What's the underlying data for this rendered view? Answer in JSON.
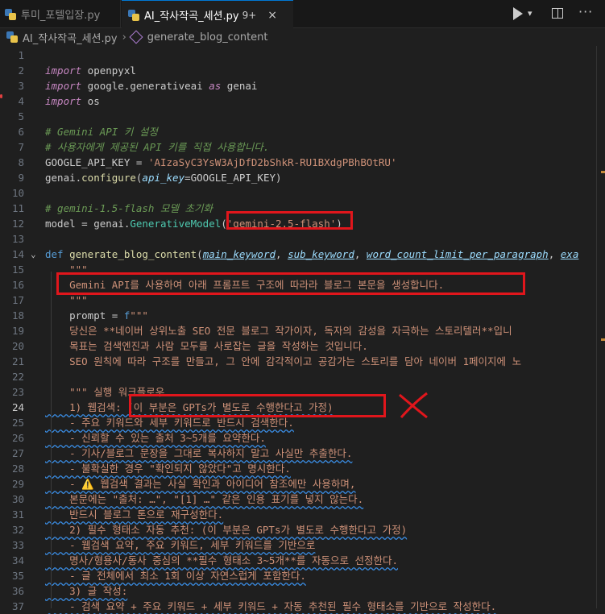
{
  "tabs": [
    {
      "label": "투미_포텔입장.py"
    },
    {
      "label": "AI_작사작곡_세션.py",
      "dirty": "9+",
      "close": "×"
    }
  ],
  "breadcrumb": {
    "file": "AI_작사작곡_세션.py",
    "separator": "›",
    "symbol": "generate_blog_content"
  },
  "colors": {
    "keyword": "#c586c0",
    "function": "#dcdcaa",
    "string": "#ce9178",
    "comment": "#6a9955",
    "annotation": "#e0161c"
  },
  "lines": [
    {
      "n": "1",
      "t": []
    },
    {
      "n": "2",
      "t": [
        {
          "c": "kw",
          "v": "import"
        },
        {
          "c": "vr",
          "v": " openpyxl"
        }
      ]
    },
    {
      "n": "3",
      "t": [
        {
          "c": "kw",
          "v": "import"
        },
        {
          "c": "vr",
          "v": " google.generativeai "
        },
        {
          "c": "kw",
          "v": "as"
        },
        {
          "c": "vr",
          "v": " genai"
        }
      ]
    },
    {
      "n": "4",
      "t": [
        {
          "c": "kw",
          "v": "import"
        },
        {
          "c": "vr",
          "v": " os"
        }
      ]
    },
    {
      "n": "5",
      "t": []
    },
    {
      "n": "6",
      "t": [
        {
          "c": "cm",
          "v": "# Gemini API 키 설정"
        }
      ]
    },
    {
      "n": "7",
      "t": [
        {
          "c": "cm",
          "v": "# 사용자에게 제공된 API 키를 직접 사용합니다."
        }
      ]
    },
    {
      "n": "8",
      "t": [
        {
          "c": "vr",
          "v": "GOOGLE_API_KEY = "
        },
        {
          "c": "st",
          "v": "'AIzaSyC3YsW3AjDfD2bShkR-RU1BXdgPBhBOtRU'"
        }
      ]
    },
    {
      "n": "9",
      "t": [
        {
          "c": "vr",
          "v": "genai."
        },
        {
          "c": "fn",
          "v": "configure"
        },
        {
          "c": "vr",
          "v": "("
        },
        {
          "c": "ky",
          "v": "api_key"
        },
        {
          "c": "vr",
          "v": "=GOOGLE_API_KEY)"
        }
      ]
    },
    {
      "n": "10",
      "t": []
    },
    {
      "n": "11",
      "t": [
        {
          "c": "cm",
          "v": "# gemini-1.5-flash 모델 초기화"
        }
      ]
    },
    {
      "n": "12",
      "t": [
        {
          "c": "vr",
          "v": "model = genai."
        },
        {
          "c": "cls",
          "v": "GenerativeModel"
        },
        {
          "c": "vr",
          "v": "("
        },
        {
          "c": "st",
          "v": "'gemini-2.5-flash'"
        },
        {
          "c": "vr",
          "v": ")"
        }
      ]
    },
    {
      "n": "13",
      "t": []
    },
    {
      "n": "14",
      "fold": "⌄",
      "t": [
        {
          "c": "df",
          "v": "def"
        },
        {
          "c": "vr",
          "v": " "
        },
        {
          "c": "fn",
          "v": "generate_blog_content"
        },
        {
          "c": "vr",
          "v": "("
        },
        {
          "c": "pm",
          "v": "main_keyword"
        },
        {
          "c": "vr",
          "v": ", "
        },
        {
          "c": "pm",
          "v": "sub_keyword"
        },
        {
          "c": "vr",
          "v": ", "
        },
        {
          "c": "pm",
          "v": "word_count_limit_per_paragraph"
        },
        {
          "c": "vr",
          "v": ", "
        },
        {
          "c": "pm",
          "v": "exa"
        }
      ]
    },
    {
      "n": "15",
      "t": [
        {
          "c": "st",
          "v": "    \"\"\""
        }
      ]
    },
    {
      "n": "16",
      "t": [
        {
          "c": "st",
          "v": "    Gemini API를 사용하여 아래 프롬프트 구조에 따라라 블로그 본문을 생성합니다."
        }
      ]
    },
    {
      "n": "17",
      "t": [
        {
          "c": "st",
          "v": "    \"\"\""
        }
      ]
    },
    {
      "n": "18",
      "t": [
        {
          "c": "vr",
          "v": "    prompt = "
        },
        {
          "c": "df",
          "v": "f"
        },
        {
          "c": "st",
          "v": "\"\"\""
        }
      ]
    },
    {
      "n": "19",
      "t": [
        {
          "c": "st",
          "v": "    당신은 **네이버 상위노출 SEO 전문 블로그 작가이자, 독자의 감성을 자극하는 스토리텔러**입니"
        }
      ]
    },
    {
      "n": "20",
      "t": [
        {
          "c": "st",
          "v": "    목표는 검색엔진과 사람 모두를 사로잡는 글을 작성하는 것입니다."
        }
      ]
    },
    {
      "n": "21",
      "t": [
        {
          "c": "st",
          "v": "    SEO 원칙에 따라 구조를 만들고, 그 안에 감각적이고 공감가는 스토리를 담아 네이버 1페이지에 노"
        }
      ]
    },
    {
      "n": "22",
      "t": []
    },
    {
      "n": "23",
      "t": [
        {
          "c": "st",
          "v": "    \"\"\" 실행 워크플로우"
        }
      ]
    },
    {
      "n": "24",
      "active": true,
      "t": [
        {
          "c": "st",
          "v": "    1) 웹검색: (이 부분은 GPTs가 별도로 수행한다고 가정)"
        }
      ]
    },
    {
      "n": "25",
      "t": [
        {
          "c": "st",
          "v": "    - 주요 키워드와 세부 키워드로 반드시 검색한다."
        }
      ]
    },
    {
      "n": "26",
      "t": [
        {
          "c": "st",
          "v": "    - 신뢰할 수 있는 출처 3~5개를 요약한다."
        }
      ]
    },
    {
      "n": "27",
      "t": [
        {
          "c": "st",
          "v": "    - 기사/블로그 문장을 그대로 복사하지 말고 사실만 추출한다."
        }
      ]
    },
    {
      "n": "28",
      "t": [
        {
          "c": "st",
          "v": "    - 불확실한 경우 \"확인되지 않았다\"고 명시한다."
        }
      ]
    },
    {
      "n": "29",
      "t": [
        {
          "c": "st",
          "v": "    - ⚠️ 웹검색 결과는 사실 확인과 아이디어 참조에만 사용하며,"
        }
      ]
    },
    {
      "n": "30",
      "t": [
        {
          "c": "st",
          "v": "    본문에는 \"출처: …\", \"[1] …\" 같은 인용 표기를 넣지 않는다."
        }
      ]
    },
    {
      "n": "31",
      "t": [
        {
          "c": "st",
          "v": "    반드시 블로그 톤으로 재구성한다."
        }
      ]
    },
    {
      "n": "32",
      "t": [
        {
          "c": "st",
          "v": "    2) 필수 형태소 자동 추천: (이 부분은 GPTs가 별도로 수행한다고 가정)"
        }
      ]
    },
    {
      "n": "33",
      "t": [
        {
          "c": "st",
          "v": "    - 웹검색 요약, 주요 키워드, 세부 키워드를 기반으로"
        }
      ]
    },
    {
      "n": "34",
      "t": [
        {
          "c": "st",
          "v": "    명사/형용사/동사 중심의 **필수 형태소 3~5개**를 자동으로 선정한다."
        }
      ]
    },
    {
      "n": "35",
      "t": [
        {
          "c": "st",
          "v": "    - 글 전체에서 최소 1회 이상 자연스럽게 포함한다."
        }
      ]
    },
    {
      "n": "36",
      "t": [
        {
          "c": "st",
          "v": "    3) 글 작성:"
        }
      ]
    },
    {
      "n": "37",
      "t": [
        {
          "c": "st",
          "v": "    - 검색 요약 + 주요 키워드 + 세부 키워드 + 자동 추천된 필수 형태소를 기반으로 작성한다."
        }
      ]
    }
  ]
}
